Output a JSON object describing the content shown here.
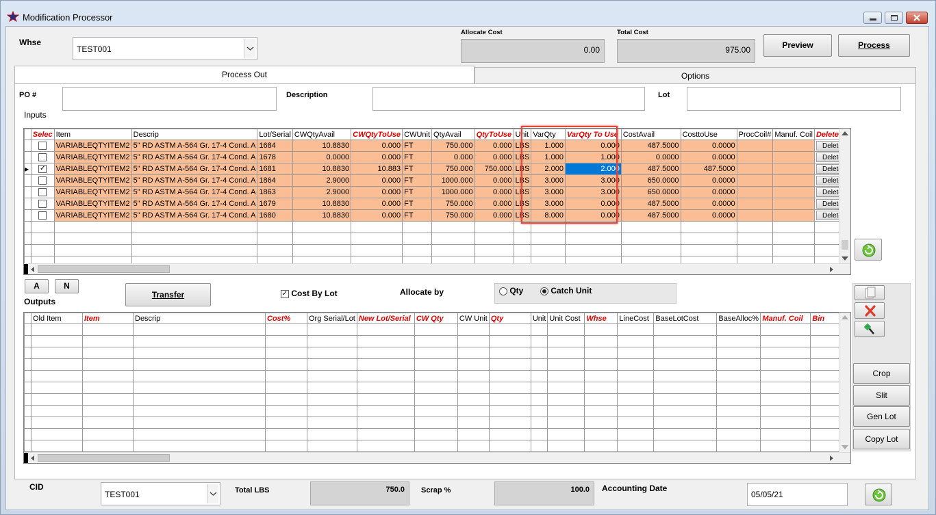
{
  "window": {
    "title": "Modification Processor"
  },
  "header": {
    "whse_label": "Whse",
    "whse_value": "TEST001",
    "allocate_cost_label": "Allocate Cost",
    "allocate_cost_value": "0.00",
    "total_cost_label": "Total Cost",
    "total_cost_value": "975.00",
    "preview_label": "Preview",
    "process_label": "Process"
  },
  "tabs": [
    {
      "label": "Process Out"
    },
    {
      "label": "Options"
    }
  ],
  "form": {
    "po_label": "PO #",
    "description_label": "Description",
    "lot_label": "Lot",
    "inputs_label": "Inputs"
  },
  "inputs_grid": {
    "columns": [
      "Selec",
      "Item",
      "Descrip",
      "Lot/Serial",
      "CWQtyAvail",
      "CWQtyToUse",
      "CWUnit",
      "QtyAvail",
      "QtyToUse",
      "Unit",
      "VarQty",
      "VarQty To Use",
      "CostAvail",
      "CosttoUse",
      "ProcCoil#",
      "Manuf. Coil",
      "Delete"
    ],
    "rows": [
      {
        "item": "VARIABLEQTYITEM2",
        "descrip": "5\" RD ASTM A-564 Gr. 17-4 Cond. A",
        "lot": "1684",
        "cwavail": "10.8830",
        "cwuse": "0.000",
        "cwunit": "FT",
        "qtyavail": "750.000",
        "qtyuse": "0.000",
        "unit": "LBS",
        "varqty": "1.000",
        "varuse": "0.000",
        "costavail": "487.5000",
        "costuse": "0.0000",
        "del": "Delete"
      },
      {
        "item": "VARIABLEQTYITEM2",
        "descrip": "5\" RD ASTM A-564 Gr. 17-4 Cond. A",
        "lot": "1678",
        "cwavail": "0.0000",
        "cwuse": "0.000",
        "cwunit": "FT",
        "qtyavail": "0.000",
        "qtyuse": "0.000",
        "unit": "LBS",
        "varqty": "1.000",
        "varuse": "1.000",
        "costavail": "0.0000",
        "costuse": "0.0000",
        "del": "Delete"
      },
      {
        "item": "VARIABLEQTYITEM2",
        "descrip": "5\" RD ASTM A-564 Gr. 17-4 Cond. A",
        "lot": "1681",
        "cwavail": "10.8830",
        "cwuse": "10.883",
        "cwunit": "FT",
        "qtyavail": "750.000",
        "qtyuse": "750.000",
        "unit": "LBS",
        "varqty": "2.000",
        "varuse": "2.000",
        "costavail": "487.5000",
        "costuse": "487.5000",
        "del": "Delete"
      },
      {
        "item": "VARIABLEQTYITEM2",
        "descrip": "5\" RD ASTM A-564 Gr. 17-4 Cond. A",
        "lot": "1864",
        "cwavail": "2.9000",
        "cwuse": "0.000",
        "cwunit": "FT",
        "qtyavail": "1000.000",
        "qtyuse": "0.000",
        "unit": "LBS",
        "varqty": "3.000",
        "varuse": "3.000",
        "costavail": "650.0000",
        "costuse": "0.0000",
        "del": "Delete"
      },
      {
        "item": "VARIABLEQTYITEM2",
        "descrip": "5\" RD ASTM A-564 Gr. 17-4 Cond. A",
        "lot": "1863",
        "cwavail": "2.9000",
        "cwuse": "0.000",
        "cwunit": "FT",
        "qtyavail": "1000.000",
        "qtyuse": "0.000",
        "unit": "LBS",
        "varqty": "3.000",
        "varuse": "3.000",
        "costavail": "650.0000",
        "costuse": "0.0000",
        "del": "Delete"
      },
      {
        "item": "VARIABLEQTYITEM2",
        "descrip": "5\" RD ASTM A-564 Gr. 17-4 Cond. A",
        "lot": "1679",
        "cwavail": "10.8830",
        "cwuse": "0.000",
        "cwunit": "FT",
        "qtyavail": "750.000",
        "qtyuse": "0.000",
        "unit": "LBS",
        "varqty": "3.000",
        "varuse": "0.000",
        "costavail": "487.5000",
        "costuse": "0.0000",
        "del": "Delete"
      },
      {
        "item": "VARIABLEQTYITEM2",
        "descrip": "5\" RD ASTM A-564 Gr. 17-4 Cond. A",
        "lot": "1680",
        "cwavail": "10.8830",
        "cwuse": "0.000",
        "cwunit": "FT",
        "qtyavail": "750.000",
        "qtyuse": "0.000",
        "unit": "LBS",
        "varqty": "8.000",
        "varuse": "0.000",
        "costavail": "487.5000",
        "costuse": "0.0000",
        "del": "Delete"
      }
    ]
  },
  "mid": {
    "a_label": "A",
    "n_label": "N",
    "outputs_label": "Outputs",
    "transfer_label": "Transfer",
    "cost_by_lot_label": "Cost By Lot",
    "allocate_by_label": "Allocate by",
    "qty_label": "Qty",
    "catch_unit_label": "Catch Unit"
  },
  "outputs_grid": {
    "columns": [
      "Old Item",
      "Item",
      "Descrip",
      "Cost%",
      "Org Serial/Lot",
      "New Lot/Serial",
      "CW Qty",
      "CW Unit",
      "Qty",
      "Unit",
      "Unit Cost",
      "Whse",
      "LineCost",
      "BaseLotCost",
      "BaseAlloc%",
      "Manuf. Coil",
      "Bin"
    ]
  },
  "side_buttons": {
    "crop": "Crop",
    "slit": "Slit",
    "gen_lot": "Gen Lot",
    "copy_lot": "Copy Lot"
  },
  "footer": {
    "cid_label": "CID",
    "cid_value": "TEST001",
    "total_lbs_label": "Total LBS",
    "total_lbs_value": "750.0",
    "scrap_label": "Scrap %",
    "scrap_value": "100.0",
    "accounting_date_label": "Accounting Date",
    "accounting_date_value": "05/05/21"
  },
  "colors": {
    "row_highlight": "#fabd94",
    "header_red": "#e00000",
    "selection": "#0078d7",
    "callout": "#e0463a"
  }
}
